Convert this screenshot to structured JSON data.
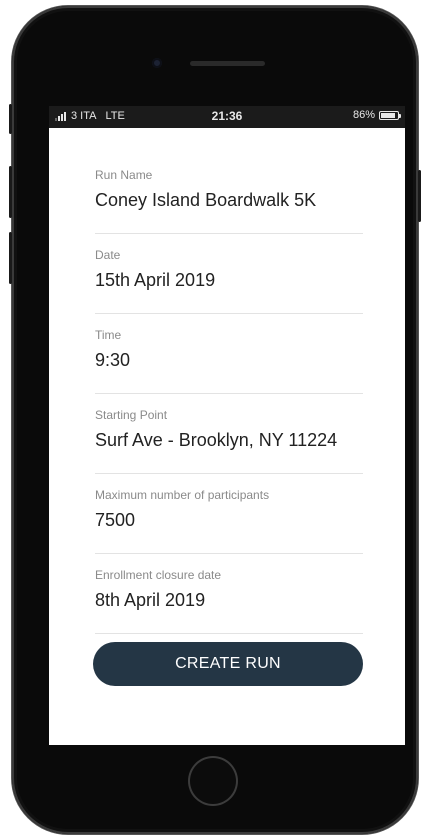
{
  "status_bar": {
    "carrier": "3 ITA",
    "network": "LTE",
    "time": "21:36",
    "battery": "86%",
    "battery_level": 0.86
  },
  "form": {
    "fields": [
      {
        "label": "Run Name",
        "value": "Coney Island Boardwalk 5K"
      },
      {
        "label": "Date",
        "value": "15th April 2019"
      },
      {
        "label": "Time",
        "value": "9:30"
      },
      {
        "label": "Starting Point",
        "value": "Surf Ave - Brooklyn, NY 11224"
      },
      {
        "label": "Maximum number of participants",
        "value": "7500"
      },
      {
        "label": "Enrollment closure date",
        "value": "8th April 2019"
      }
    ],
    "submit_label": "CREATE RUN"
  },
  "colors": {
    "button": "#243645",
    "label": "#8a8a8a",
    "value": "#222222"
  }
}
